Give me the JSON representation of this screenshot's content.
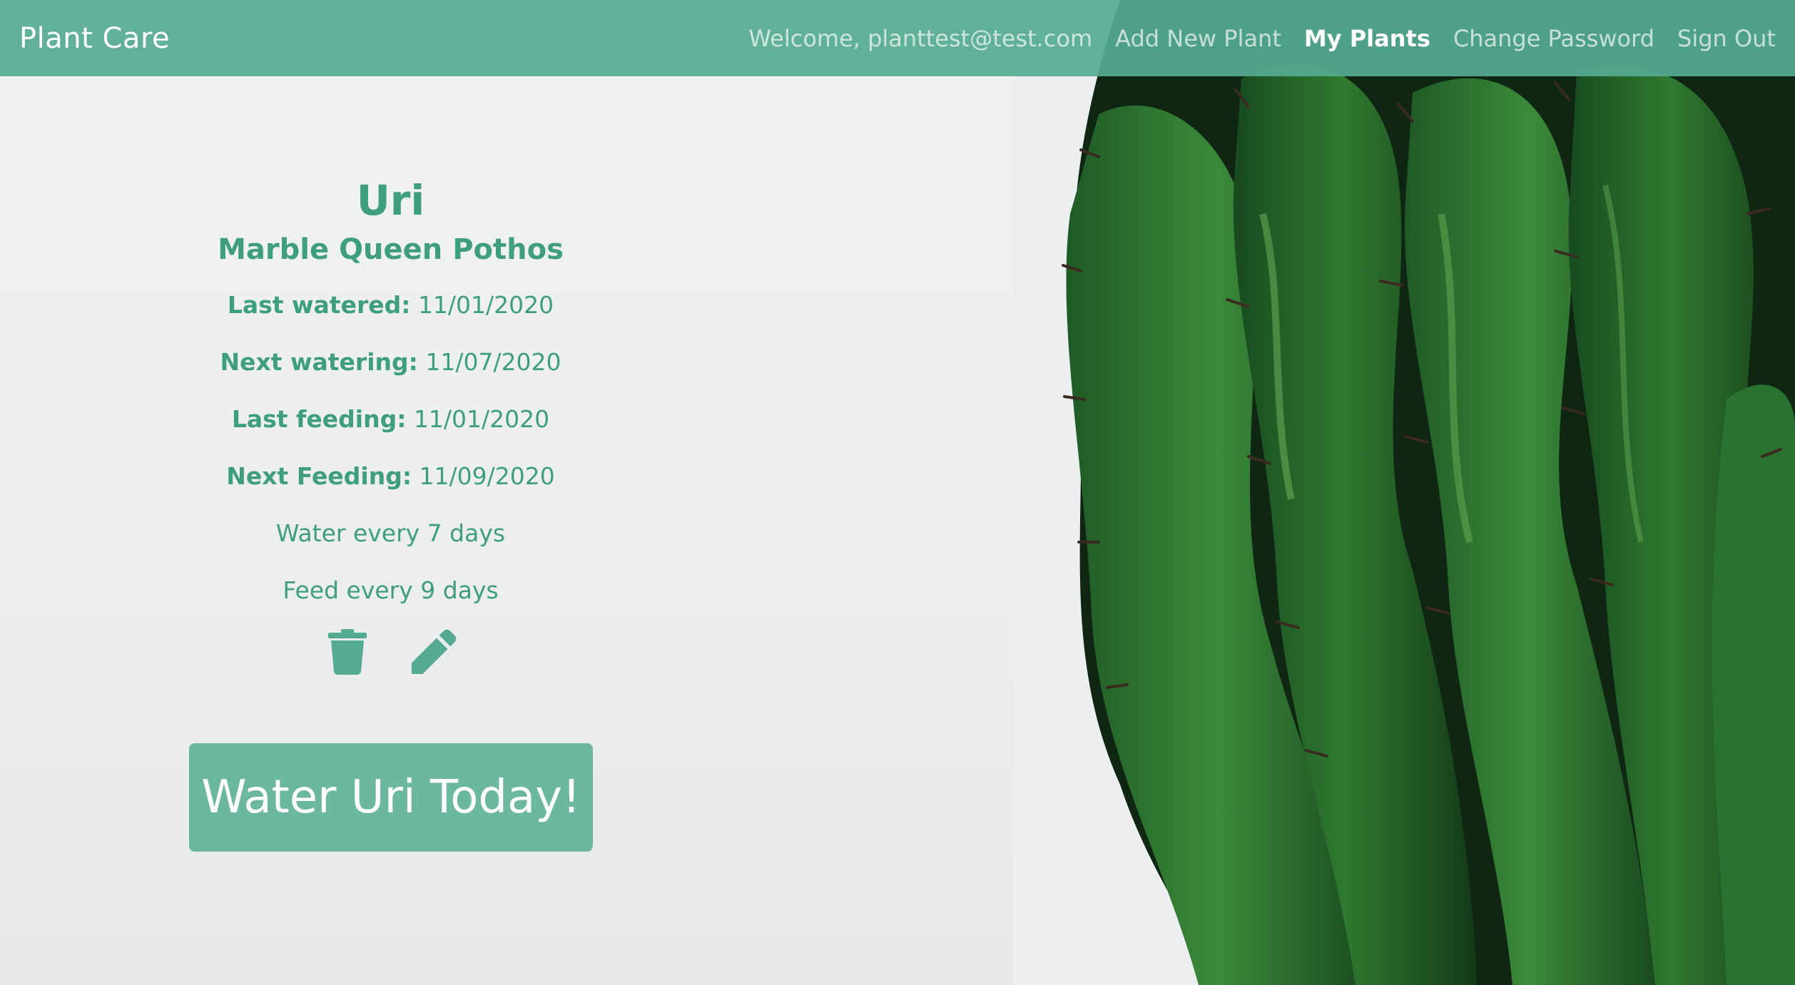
{
  "navbar": {
    "brand": "Plant Care",
    "welcome": "Welcome, planttest@test.com",
    "links": [
      "Add New Plant",
      "My Plants",
      "Change Password",
      "Sign Out"
    ],
    "active_link": "My Plants"
  },
  "plant": {
    "name": "Uri",
    "species": "Marble Queen Pothos",
    "last_watered_label": "Last watered:",
    "last_watered_value": "11/01/2020",
    "next_watering_label": "Next watering:",
    "next_watering_value": "11/07/2020",
    "last_feeding_label": "Last feeding:",
    "last_feeding_value": "11/01/2020",
    "next_feeding_label": "Next Feeding:",
    "next_feeding_value": "11/09/2020",
    "water_frequency": "Water every 7 days",
    "feed_frequency": "Feed every 9 days",
    "delete_icon": "trash-icon",
    "edit_icon": "pencil-icon",
    "water_button": "Water Uri Today!"
  },
  "colors": {
    "navbar": "#55aa92",
    "accent": "#3e9e7f",
    "button": "#6bb7a0"
  }
}
